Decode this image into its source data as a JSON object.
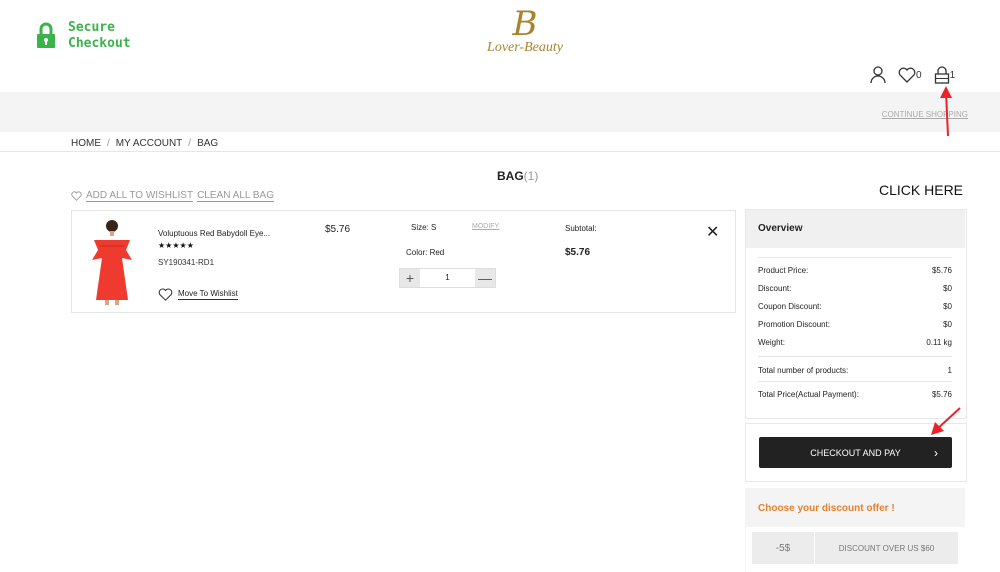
{
  "header": {
    "secure_line1": "Secure",
    "secure_line2": "Checkout",
    "logo_mark": "B",
    "logo_text": "Lover-Beauty",
    "wishlist_count": "0",
    "bag_count": "1",
    "continue_shopping": "CONTINUE SHOPPING"
  },
  "breadcrumb": [
    "HOME",
    "MY ACCOUNT",
    "BAG"
  ],
  "bag": {
    "title": "BAG",
    "count": "(1)",
    "add_all_wishlist": "ADD ALL TO WISHLIST",
    "clean_all": "CLEAN ALL BAG"
  },
  "annotation": {
    "click_here": "CLICK HERE"
  },
  "item": {
    "name": "Voluptuous Red Babydoll Eye...",
    "stars": "★★★★★",
    "sku": "SY190341-RD1",
    "move_to_wishlist": "Move To Wishlist",
    "price": "$5.76",
    "size": "Size: S",
    "modify": "MODIFY",
    "color": "Color: Red",
    "qty_minus_symbol": "+",
    "qty": "1",
    "qty_plus_symbol": "—",
    "subtotal_label": "Subtotal:",
    "subtotal_value": "$5.76",
    "remove": "✕"
  },
  "overview": {
    "title": "Overview",
    "rows": [
      {
        "label": "Product Price:",
        "value": "$5.76"
      },
      {
        "label": "Discount:",
        "value": "$0"
      },
      {
        "label": "Coupon Discount:",
        "value": "$0"
      },
      {
        "label": "Promotion Discount:",
        "value": "$0"
      },
      {
        "label": "Weight:",
        "value": "0.11 kg"
      },
      {
        "label": "Total number of products:",
        "value": "1"
      },
      {
        "label": "Total Price(Actual Payment):",
        "value": "$5.76"
      }
    ]
  },
  "checkout": {
    "label": "CHECKOUT AND PAY",
    "chevron": "›"
  },
  "discount": {
    "title": "Choose your discount offer !",
    "coupon_amount": "-5$",
    "coupon_desc": "DISCOUNT OVER US $60"
  },
  "colors": {
    "secure_green": "#3ab34a",
    "brand_gold": "#a8822f",
    "arrow_red": "#e8242a",
    "discount_orange": "#e8802c"
  }
}
